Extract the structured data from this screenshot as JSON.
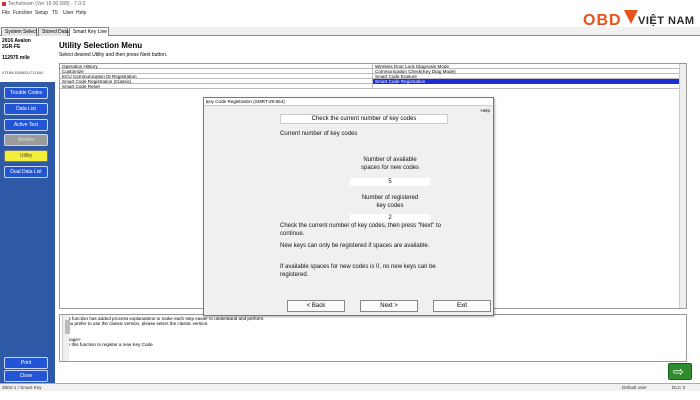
{
  "window": {
    "title": "Techstream (Ver 16.00.008)  -  7.0.0"
  },
  "menu": [
    "File",
    "Function",
    "Setup",
    "T5",
    "User",
    "Help"
  ],
  "tabs": [
    "System Select",
    "Stored Data",
    "Smart Key Live"
  ],
  "vehicle": {
    "model": "2016 Avalon",
    "engine": "2GR-FE",
    "mileage": "112975 mile",
    "vin": "4T1BK1EB8GU711180"
  },
  "sidebar": {
    "buttons": [
      "Trouble Codes",
      "Data List",
      "Active Test",
      "Monitor",
      "Utility",
      "Dual Data List"
    ],
    "bottom": [
      "Print",
      "Close"
    ]
  },
  "main": {
    "title": "Utility Selection Menu",
    "subtitle": "Select desired Utility and then press Next button.",
    "rows": [
      [
        "Operation History",
        "Wireless Door Lock Diagnosis Mode"
      ],
      [
        "Customize",
        "Communication Check(Key Diag Mode)"
      ],
      [
        "ECU Communication ID Registration",
        "Smart Code Erasure"
      ],
      [
        "Smart Code Registration (Classic)",
        "Smart Code Registration"
      ],
      [
        "Smart Code Reset",
        ""
      ]
    ],
    "selected": {
      "row": 3,
      "col": 2
    },
    "desc": [
      "This function has added process explanations to make each step easier to understand and perform.",
      "If you prefer to use the classic version, please select the classic version.",
      "",
      "<Usage>",
      "Use this function to register a new Key Code"
    ]
  },
  "status": {
    "left": "2804-1 / Smart Key",
    "mid": "Default user",
    "right": "DLC 3"
  },
  "dialog": {
    "title": "Key Code Registration (SMRT-29-564)",
    "help": "Help",
    "header": "Check the current number of key codes",
    "current_label": "Current number of key codes",
    "avail_label_1": "Number of available",
    "avail_label_2": "spaces for new codes",
    "avail_value": "5",
    "reg_label_1": "Number of registered",
    "reg_label_2": "key codes",
    "reg_value": "2",
    "msg1a": "Check the current number of key codes, then press \"Next\" to",
    "msg1b": "continue.",
    "msg2": "New keys can only be registered if spaces are available.",
    "msg3a": "If available spaces for new codes is 0, no new keys can be",
    "msg3b": "registered.",
    "back": "< Back",
    "next": "Next >",
    "exit": "Exit"
  },
  "logo": {
    "obd": "OBD",
    "vn": "VIỆT NAM"
  },
  "colors": {
    "sidebar": "#2e59a6",
    "button": "#2255d6",
    "selected": "#1a2dd6",
    "logo": "#e8521c"
  }
}
